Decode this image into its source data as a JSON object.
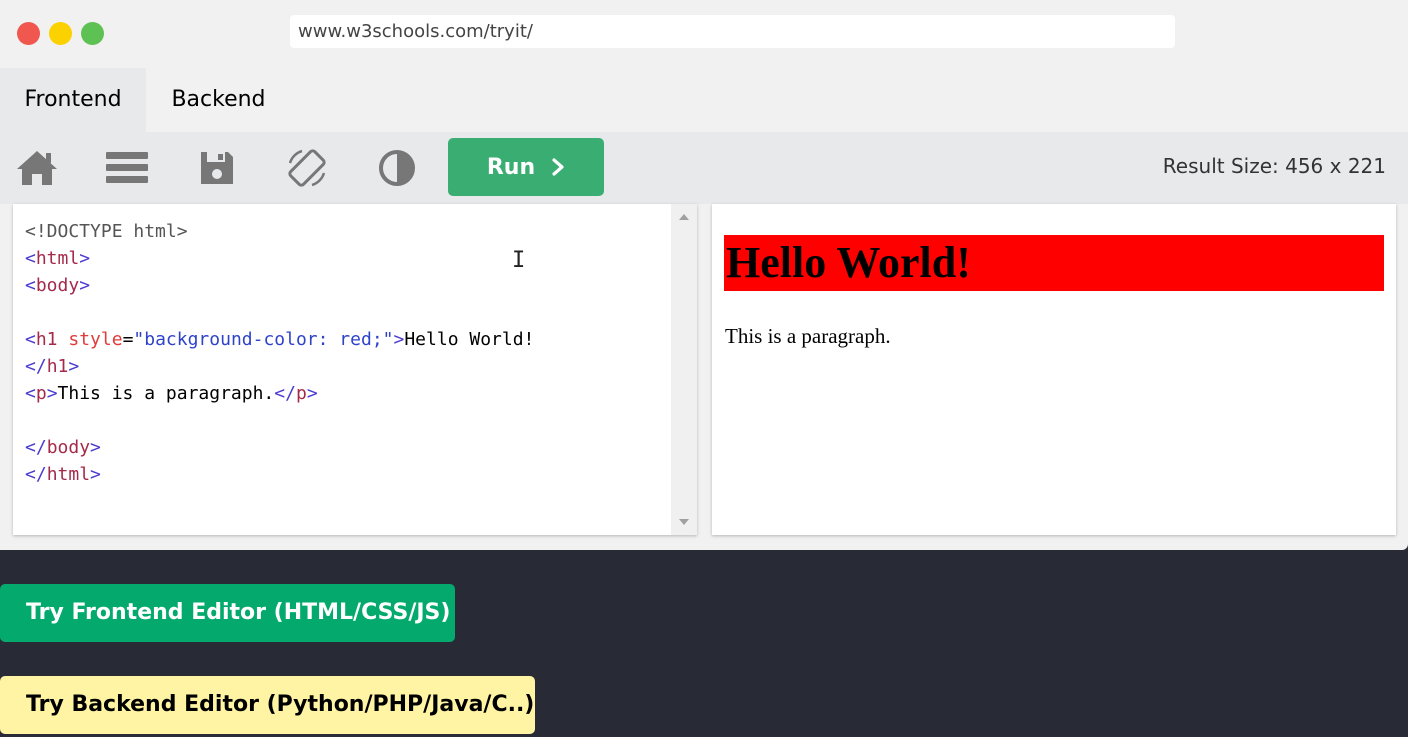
{
  "browser": {
    "url": "www.w3schools.com/tryit/"
  },
  "tabs": [
    {
      "label": "Frontend",
      "active": true
    },
    {
      "label": "Backend",
      "active": false
    }
  ],
  "toolbar": {
    "icons": [
      "home-icon",
      "menu-icon",
      "save-icon",
      "rotate-icon",
      "contrast-icon"
    ],
    "run_label": "Run",
    "result_size": "Result Size: 456 x 221"
  },
  "editor": {
    "lines": [
      "<!DOCTYPE html>",
      "<html>",
      "<body>",
      "",
      "<h1 style=\"background-color: red;\">Hello World!",
      "</h1>",
      "<p>This is a paragraph.</p>",
      "",
      "</body>",
      "</html>"
    ]
  },
  "result": {
    "heading": "Hello World!",
    "heading_bg": "#ff0000",
    "paragraph": "This is a paragraph."
  },
  "cta": {
    "frontend_label": "Try Frontend Editor (HTML/CSS/JS)",
    "backend_label": "Try Backend Editor (Python/PHP/Java/C..)",
    "frontend_color": "#04aa6d",
    "backend_color": "#fff4a3"
  }
}
